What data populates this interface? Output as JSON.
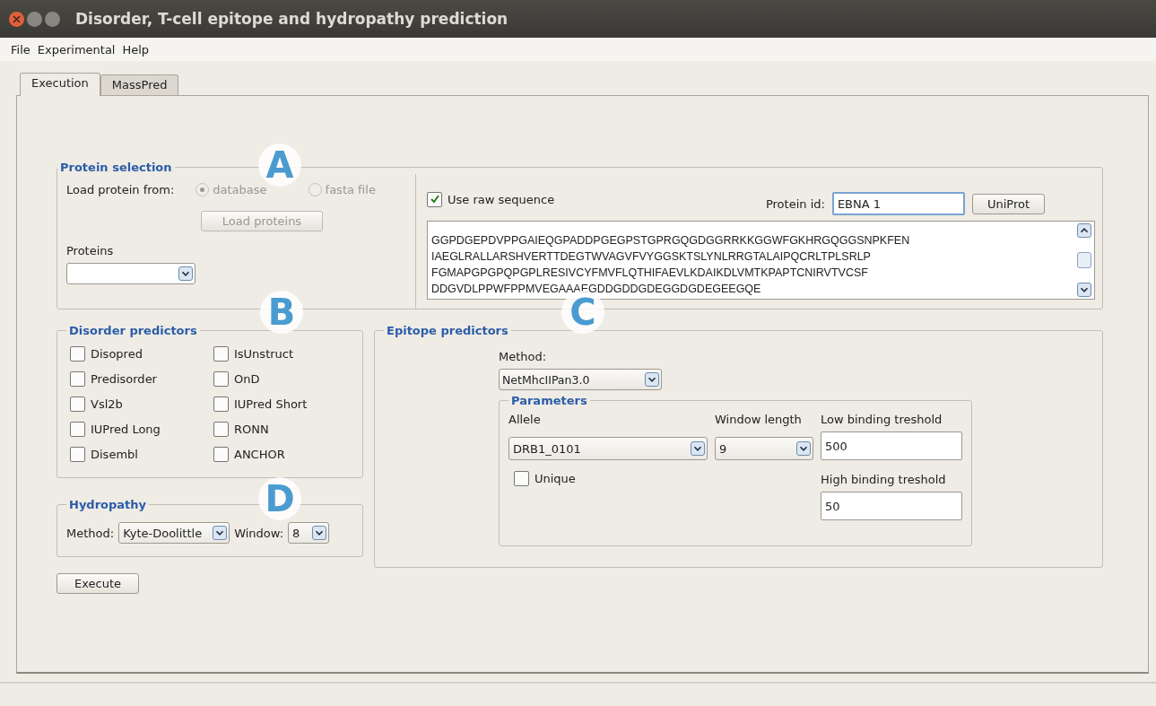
{
  "window": {
    "title": "Disorder, T-cell epitope and hydropathy prediction"
  },
  "menu": [
    "File",
    "Experimental",
    "Help"
  ],
  "tabs": [
    {
      "label": "Execution",
      "selected": true
    },
    {
      "label": "MassPred",
      "selected": false
    }
  ],
  "protein_selection": {
    "title": "Protein selection",
    "load_from_label": "Load protein from:",
    "sources": [
      {
        "label": "database",
        "selected": true,
        "disabled": true
      },
      {
        "label": "fasta file",
        "selected": false,
        "disabled": true
      }
    ],
    "load_button": {
      "label": "Load proteins",
      "disabled": true
    },
    "proteins_label": "Proteins",
    "use_raw": {
      "label": "Use raw sequence",
      "checked": true
    },
    "protein_id_label": "Protein id:",
    "protein_id": "EBNA 1",
    "uniprot_button": "UniProt",
    "sequence": [
      "GGPDGEPDVPPGAIEQGPADDPGEGPSTGPRGQGDGGRRKKGGWFGKHRGQGGSNPKFEN",
      "IAEGLRALLARSHVERTTDEGTWVAGVFVYGGSKTSLYNLRRGTALAIPQCRLTPLSRLP",
      "FGMAPGPGPQPGPLRESIVCYFMVFLQTHIFAEVLKDAIKDLVMTKPAPTCNIRVTVCSF",
      "DDGVDLPPWFPPMVEGAAAEGDDGDDGDEGGDGDEGEEGQE"
    ]
  },
  "disorder": {
    "title": "Disorder predictors",
    "items": [
      {
        "label": "Disopred",
        "checked": false
      },
      {
        "label": "IsUnstruct",
        "checked": false
      },
      {
        "label": "Predisorder",
        "checked": false
      },
      {
        "label": "OnD",
        "checked": false
      },
      {
        "label": "Vsl2b",
        "checked": false
      },
      {
        "label": "IUPred Short",
        "checked": false
      },
      {
        "label": "IUPred Long",
        "checked": false
      },
      {
        "label": "RONN",
        "checked": false
      },
      {
        "label": "Disembl",
        "checked": false
      },
      {
        "label": "ANCHOR",
        "checked": false
      }
    ]
  },
  "hydropathy": {
    "title": "Hydropathy",
    "method_label": "Method:",
    "method": "Kyte-Doolittle",
    "window_label": "Window:",
    "window": "8"
  },
  "execute_button": "Execute",
  "epitope": {
    "title": "Epitope predictors",
    "method_label": "Method:",
    "method": "NetMhcIIPan3.0",
    "parameters": {
      "title": "Parameters",
      "allele_label": "Allele",
      "allele": "DRB1_0101",
      "window_length_label": "Window length",
      "window_length": "9",
      "low_label": "Low binding treshold",
      "low": "500",
      "unique": {
        "label": "Unique",
        "checked": false
      },
      "high_label": "High binding treshold",
      "high": "50"
    }
  },
  "annotations": [
    "A",
    "B",
    "C",
    "D"
  ]
}
